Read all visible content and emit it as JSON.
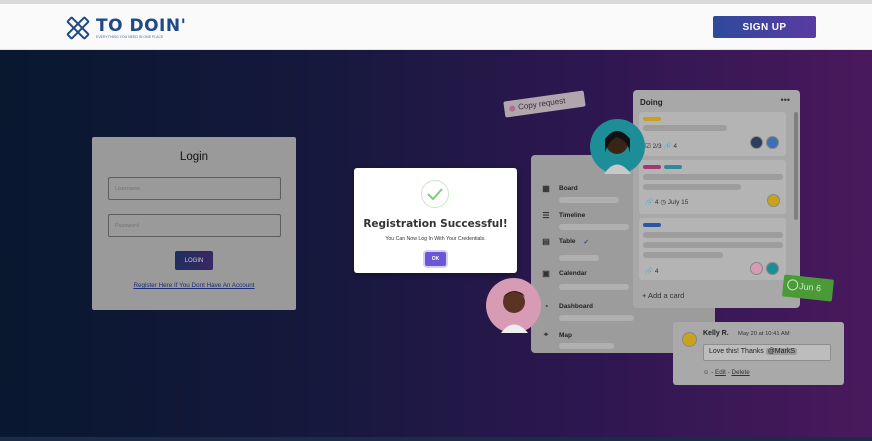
{
  "header": {
    "brand": "TO DOIN'",
    "tagline": "EVERYTHING YOU NEED IN ONE PLACE",
    "signup_label": "SIGN UP"
  },
  "login": {
    "title": "Login",
    "username_placeholder": "Username",
    "password_placeholder": "Password",
    "button_label": "LOGIN",
    "register_link": "Register Here If You Dont Have An Account"
  },
  "modal": {
    "title": "Registration Successful!",
    "message": "You Can Now Log In With Your Credentials.",
    "ok_label": "OK"
  },
  "illustration": {
    "copy_request": "Copy request",
    "sidebar": [
      "Board",
      "Timeline",
      "Table",
      "Calendar",
      "Dashboard",
      "Map"
    ],
    "table_check": "✓",
    "list_title": "Doing",
    "list_menu": "•••",
    "card1_meta": "☑ 2/3  🔗 4",
    "card2_meta": "🔗 4  ◷ July 15",
    "card3_meta": "🔗 4",
    "add_card": "+ Add a card",
    "date_badge": "Jun 6",
    "comment": {
      "author": "Kelly R.",
      "time": "May 20 at 10:41 AM",
      "text": "Love this! Thanks",
      "mention": "@MarkS",
      "emoji": "☺",
      "dash1": "-",
      "edit": "Edit",
      "dash2": "-",
      "delete": "Delete"
    }
  },
  "colors": {
    "brand": "#1f4a86",
    "signup_gradient_start": "#2e4a9b",
    "signup_gradient_end": "#5b3aa3",
    "ok_button": "#6c56d8",
    "success_check": "#7ccf6f",
    "date_badge": "#4a9a37"
  }
}
